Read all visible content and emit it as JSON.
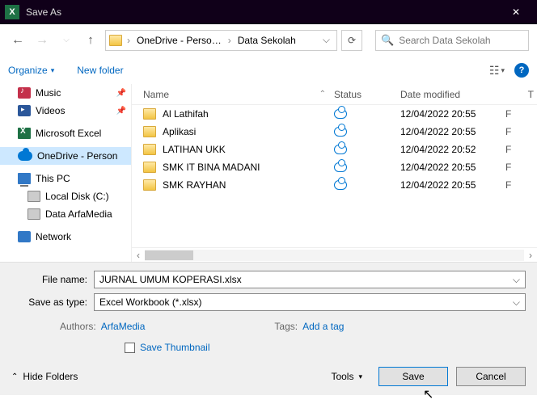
{
  "window": {
    "title": "Save As"
  },
  "nav": {
    "crumb1": "OneDrive - Perso…",
    "crumb2": "Data Sekolah",
    "search_placeholder": "Search Data Sekolah"
  },
  "toolbar": {
    "organize": "Organize",
    "new_folder": "New folder"
  },
  "sidebar": {
    "music": "Music",
    "videos": "Videos",
    "excel": "Microsoft Excel",
    "onedrive": "OneDrive - Person",
    "thispc": "This PC",
    "localdisk": "Local Disk (C:)",
    "arfa": "Data ArfaMedia",
    "network": "Network"
  },
  "columns": {
    "name": "Name",
    "status": "Status",
    "date": "Date modified"
  },
  "files": [
    {
      "name": "Al Lathifah",
      "date": "12/04/2022 20:55"
    },
    {
      "name": "Aplikasi",
      "date": "12/04/2022 20:55"
    },
    {
      "name": "LATIHAN UKK",
      "date": "12/04/2022 20:52"
    },
    {
      "name": "SMK IT BINA MADANI",
      "date": "12/04/2022 20:55"
    },
    {
      "name": "SMK RAYHAN",
      "date": "12/04/2022 20:55"
    }
  ],
  "form": {
    "filename_label": "File name:",
    "filename_value": "JURNAL UMUM KOPERASI.xlsx",
    "type_label": "Save as type:",
    "type_value": "Excel Workbook (*.xlsx)",
    "authors_label": "Authors:",
    "authors_value": "ArfaMedia",
    "tags_label": "Tags:",
    "tags_value": "Add a tag",
    "save_thumb": "Save Thumbnail"
  },
  "footer": {
    "hide_folders": "Hide Folders",
    "tools": "Tools",
    "save": "Save",
    "cancel": "Cancel"
  }
}
